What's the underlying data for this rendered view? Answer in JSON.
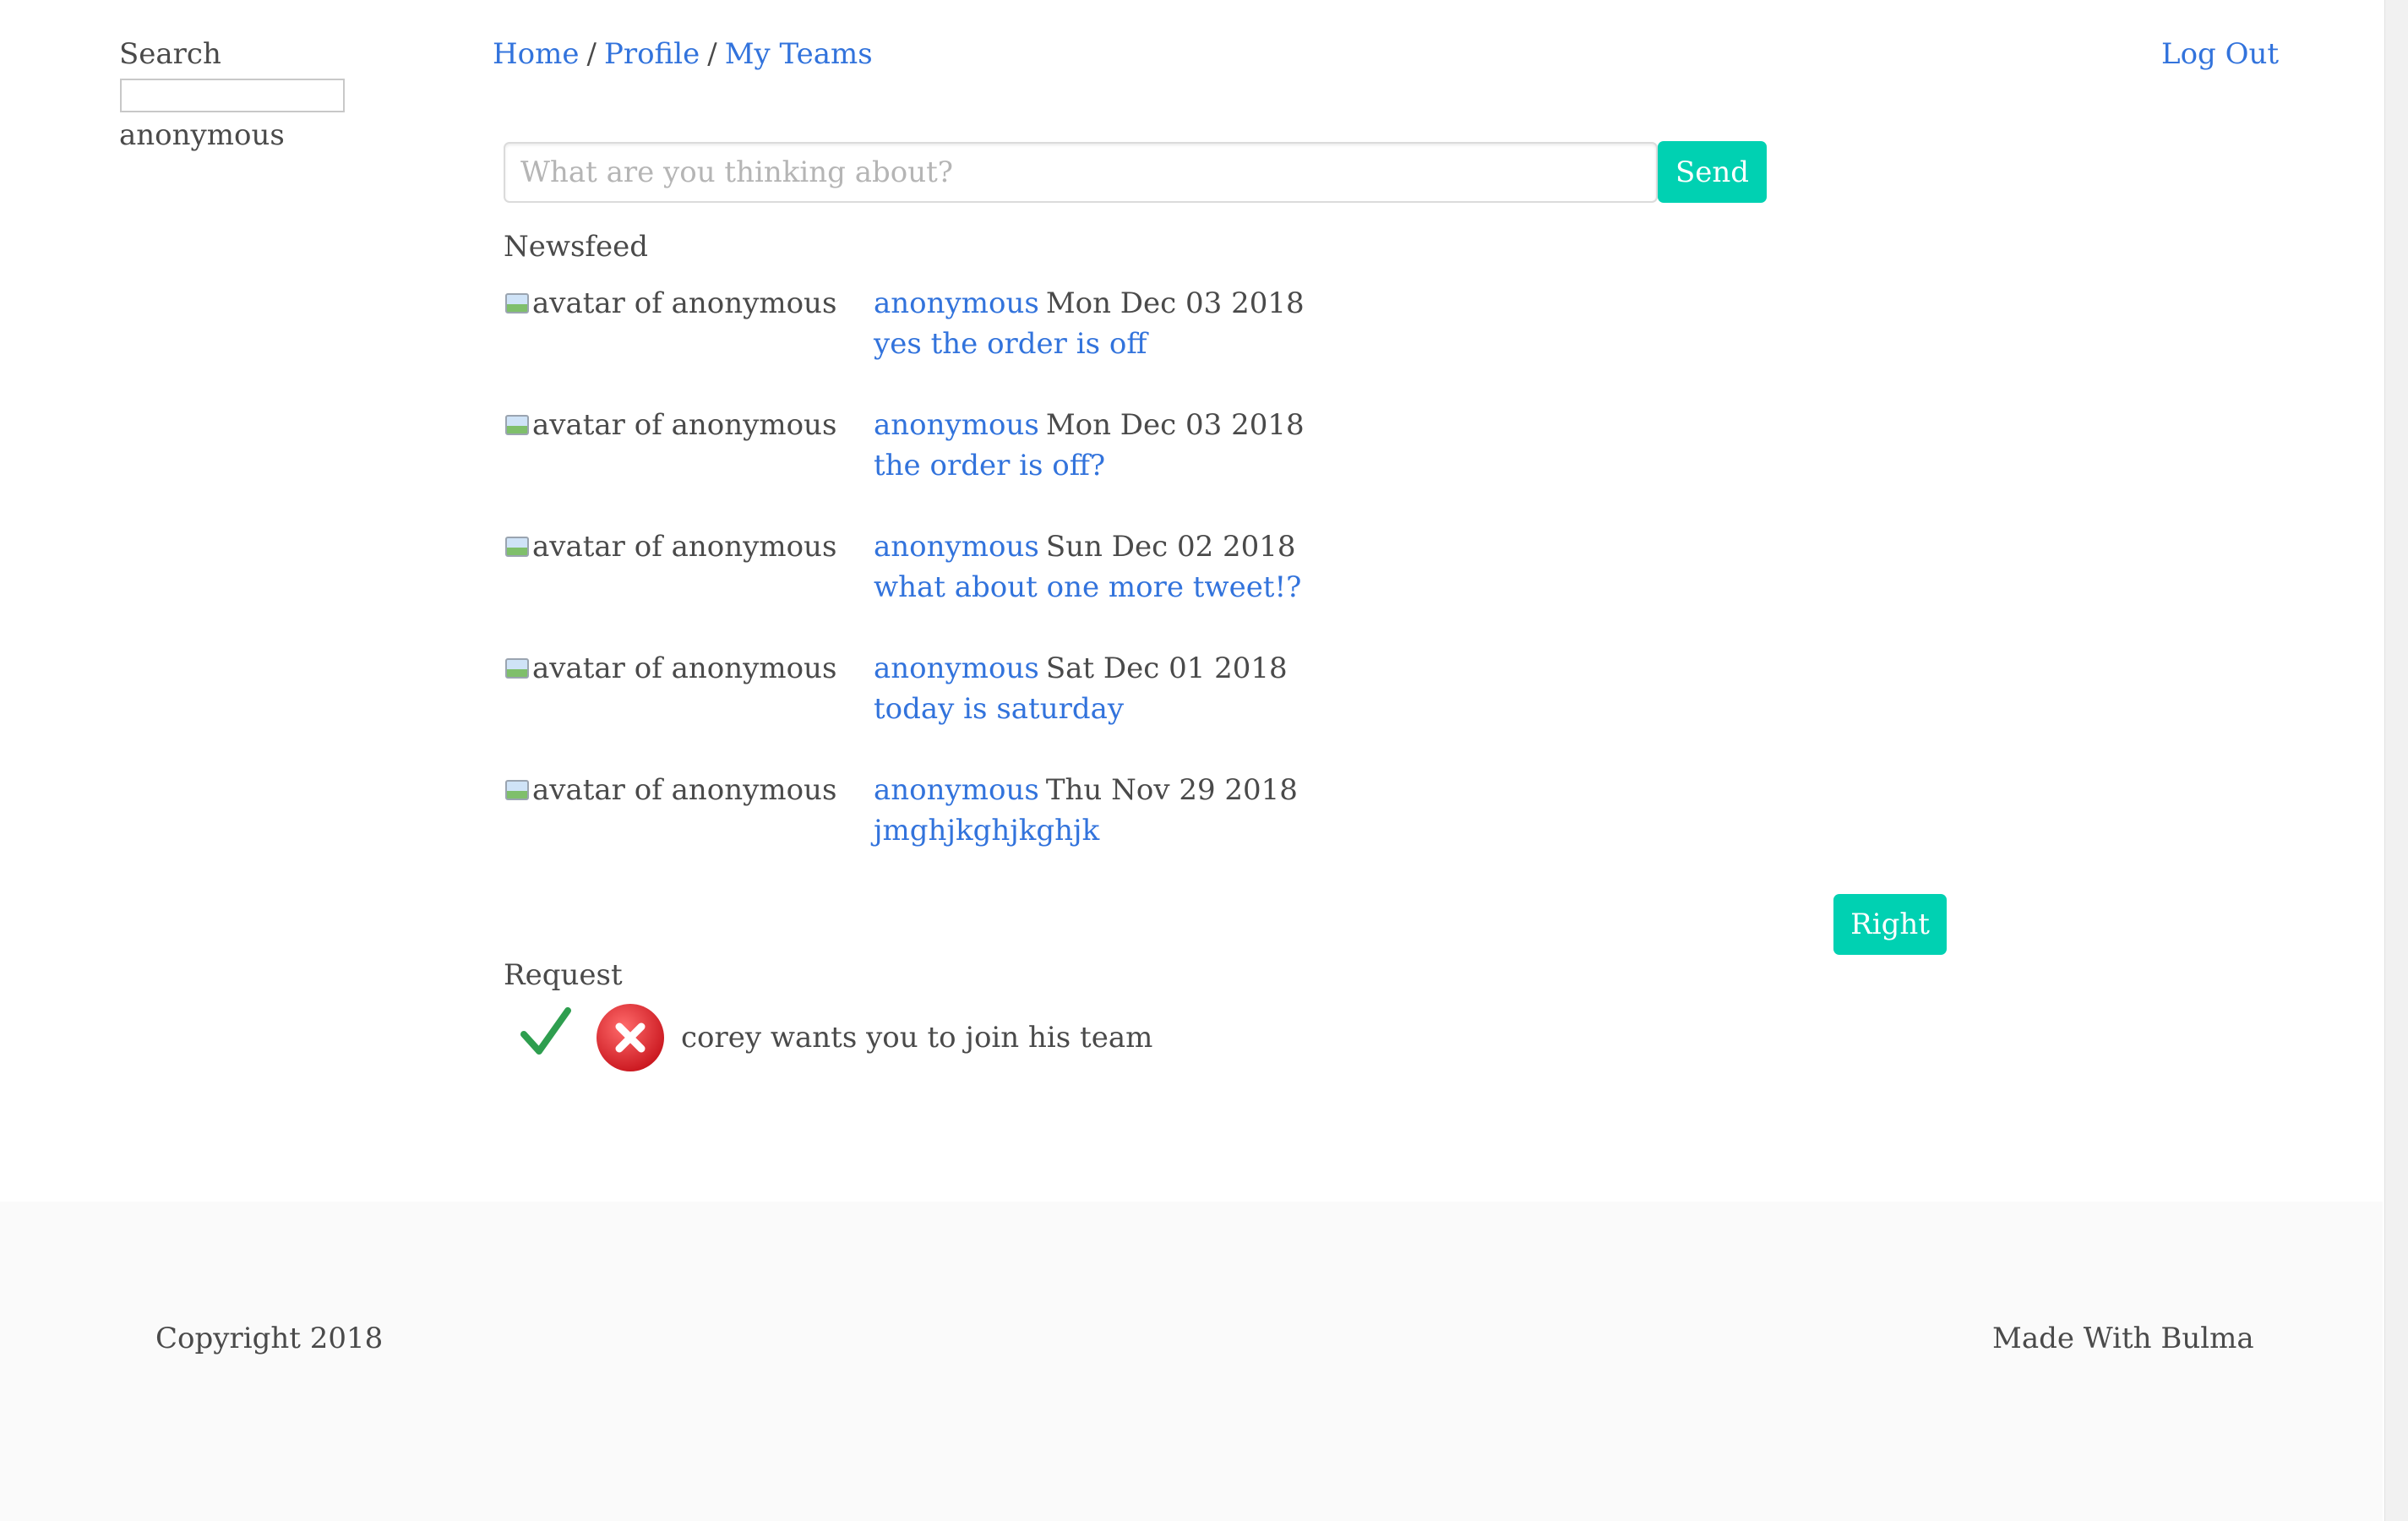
{
  "sidebar": {
    "search_label": "Search",
    "search_value": "",
    "username": "anonymous"
  },
  "nav": {
    "home": "Home",
    "profile": "Profile",
    "teams": "My Teams",
    "separator": "/",
    "logout": "Log Out"
  },
  "composer": {
    "placeholder": "What are you thinking about?",
    "send_label": "Send"
  },
  "newsfeed": {
    "title": "Newsfeed",
    "items": [
      {
        "avatar_alt": "avatar of anonymous",
        "author": "anonymous",
        "date": "Mon Dec 03 2018",
        "text": "yes the order is off"
      },
      {
        "avatar_alt": "avatar of anonymous",
        "author": "anonymous",
        "date": "Mon Dec 03 2018",
        "text": "the order is off?"
      },
      {
        "avatar_alt": "avatar of anonymous",
        "author": "anonymous",
        "date": "Sun Dec 02 2018",
        "text": "what about one more tweet!?"
      },
      {
        "avatar_alt": "avatar of anonymous",
        "author": "anonymous",
        "date": "Sat Dec 01 2018",
        "text": "today is saturday"
      },
      {
        "avatar_alt": "avatar of anonymous",
        "author": "anonymous",
        "date": "Thu Nov 29 2018",
        "text": "jmghjkghjkghjk"
      }
    ],
    "right_button_label": "Right"
  },
  "request": {
    "title": "Request",
    "text": "corey wants you to join his team",
    "accept_icon": "checkmark-icon",
    "decline_icon": "close-circle-icon"
  },
  "footer": {
    "copyright": "Copyright 2018",
    "made_with": "Made With Bulma"
  },
  "colors": {
    "link": "#3273dc",
    "primary_button": "#00d1b2",
    "text": "#4a4a4a",
    "footer_bg": "#fafafa",
    "accept_green": "#2e9e4f",
    "decline_red": "#d9262c"
  }
}
